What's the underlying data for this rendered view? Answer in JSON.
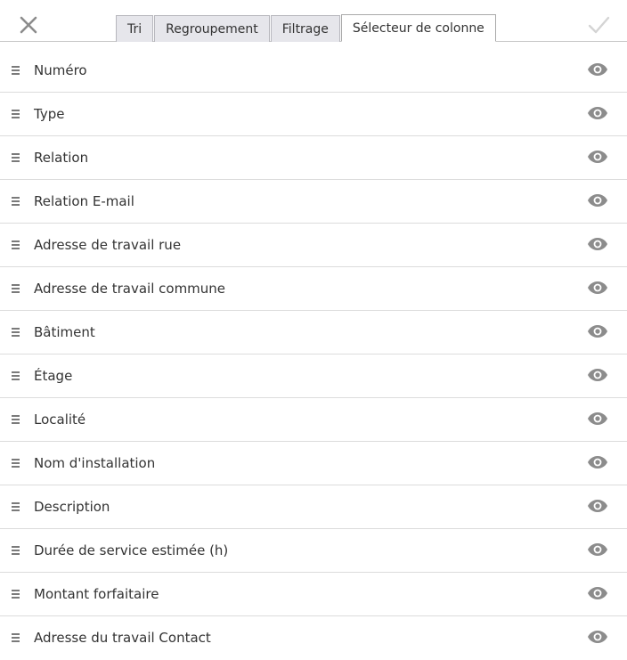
{
  "toolbar": {
    "close_icon": "close-icon",
    "confirm_icon": "checkmark-icon"
  },
  "tabs": [
    {
      "label": "Tri",
      "active": false
    },
    {
      "label": "Regroupement",
      "active": false
    },
    {
      "label": "Filtrage",
      "active": false
    },
    {
      "label": "Sélecteur de colonne",
      "active": true
    }
  ],
  "columns": [
    {
      "label": "Numéro",
      "visible": true
    },
    {
      "label": "Type",
      "visible": true
    },
    {
      "label": "Relation",
      "visible": true
    },
    {
      "label": "Relation E-mail",
      "visible": true
    },
    {
      "label": "Adresse de travail rue",
      "visible": true
    },
    {
      "label": "Adresse de travail commune",
      "visible": true
    },
    {
      "label": "Bâtiment",
      "visible": true
    },
    {
      "label": "Étage",
      "visible": true
    },
    {
      "label": "Localité",
      "visible": true
    },
    {
      "label": "Nom d'installation",
      "visible": true
    },
    {
      "label": "Description",
      "visible": true
    },
    {
      "label": "Durée de service estimée (h)",
      "visible": true
    },
    {
      "label": "Montant forfaitaire",
      "visible": true
    },
    {
      "label": "Adresse du travail Contact",
      "visible": true
    }
  ],
  "colors": {
    "icon_gray": "#8c8c8c",
    "confirm_disabled": "#d4d4d4",
    "tab_inactive_bg": "#e6e6eb",
    "divider": "#dcdcdc"
  }
}
